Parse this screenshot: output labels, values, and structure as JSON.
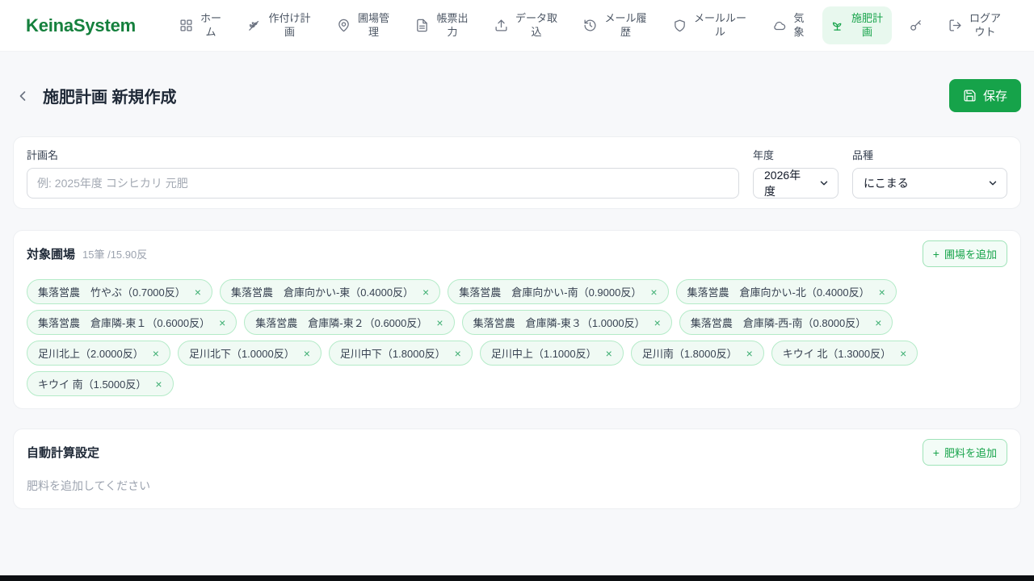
{
  "brand": "KeinaSystem",
  "nav": {
    "items": [
      {
        "icon": "grid-icon",
        "label": "ホーム"
      },
      {
        "icon": "wheat-icon",
        "label": "作付け計画"
      },
      {
        "icon": "map-pin-icon",
        "label": "圃場管理"
      },
      {
        "icon": "file-icon",
        "label": "帳票出力"
      },
      {
        "icon": "upload-icon",
        "label": "データ取込"
      },
      {
        "icon": "history-icon",
        "label": "メール履歴"
      },
      {
        "icon": "shield-icon",
        "label": "メールルール"
      },
      {
        "icon": "cloud-icon",
        "label": "気象"
      },
      {
        "icon": "sprout-icon",
        "label": "施肥計画",
        "active": true
      },
      {
        "icon": "key-icon"
      },
      {
        "icon": "logout-icon",
        "label": "ログアウト"
      }
    ]
  },
  "header": {
    "title": "施肥計画 新規作成",
    "save_label": "保存"
  },
  "plan_form": {
    "name_label": "計画名",
    "name_placeholder": "例: 2025年度 コシヒカリ 元肥",
    "name_value": "",
    "year_label": "年度",
    "year_value": "2026年度",
    "variety_label": "品種",
    "variety_value": "にこまる"
  },
  "fields_section": {
    "title": "対象圃場",
    "summary": "15筆 /15.90反",
    "add_button_label": "圃場を追加",
    "tags": [
      "集落営農　竹やぶ（0.7000反）",
      "集落営農　倉庫向かい-東（0.4000反）",
      "集落営農　倉庫向かい-南（0.9000反）",
      "集落営農　倉庫向かい-北（0.4000反）",
      "集落営農　倉庫隣-東１（0.6000反）",
      "集落営農　倉庫隣-東２（0.6000反）",
      "集落営農　倉庫隣-東３（1.0000反）",
      "集落営農　倉庫隣-西-南（0.8000反）",
      "足川北上（2.0000反）",
      "足川北下（1.0000反）",
      "足川中下（1.8000反）",
      "足川中上（1.1000反）",
      "足川南（1.8000反）",
      "キウイ 北（1.3000反）",
      "キウイ 南（1.5000反）"
    ]
  },
  "calc_section": {
    "title": "自動計算設定",
    "add_button_label": "肥料を追加",
    "empty_message": "肥料を追加してください"
  },
  "icons": {
    "plus": "+",
    "close": "×"
  },
  "colors": {
    "primary_green": "#16a34a",
    "logo_green": "#15803d",
    "active_nav_bg": "#e8f8ee",
    "tag_bg": "#f0faf4",
    "tag_border": "#b4ebc8",
    "page_bg": "#f7f8fa"
  }
}
